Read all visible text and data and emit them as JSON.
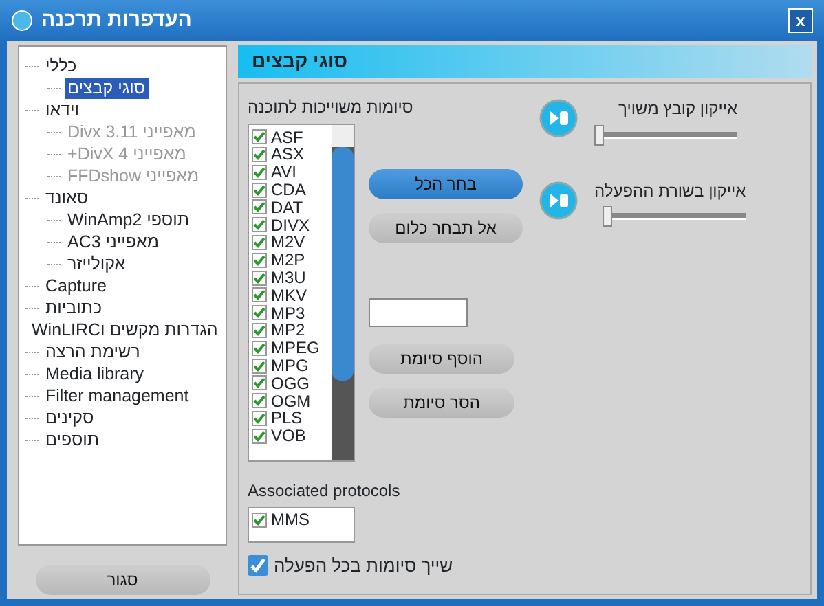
{
  "window": {
    "title": "העדפרות תרכנה",
    "close": "x"
  },
  "tree": [
    {
      "label": "כללי",
      "selected": false,
      "disabled": false,
      "children": [
        {
          "label": "סוגי קבצים",
          "selected": true,
          "disabled": false
        }
      ]
    },
    {
      "label": "וידאו",
      "selected": false,
      "disabled": false,
      "children": [
        {
          "label": "מאפייני Divx 3.11",
          "selected": false,
          "disabled": true
        },
        {
          "label": "מאפייני DivX 4+",
          "selected": false,
          "disabled": true
        },
        {
          "label": "מאפייני FFDshow",
          "selected": false,
          "disabled": true
        }
      ]
    },
    {
      "label": "סאונד",
      "selected": false,
      "disabled": false,
      "children": [
        {
          "label": "תוספי WinAmp2",
          "selected": false,
          "disabled": false
        },
        {
          "label": "מאפייני AC3",
          "selected": false,
          "disabled": false
        },
        {
          "label": "אקולייזר",
          "selected": false,
          "disabled": false
        }
      ]
    },
    {
      "label": "Capture",
      "selected": false,
      "disabled": false
    },
    {
      "label": "כתוביות",
      "selected": false,
      "disabled": false
    },
    {
      "label": "הגדרות מקשים וWinLIRC",
      "selected": false,
      "disabled": false
    },
    {
      "label": "רשימת הרצה",
      "selected": false,
      "disabled": false
    },
    {
      "label": "Media library",
      "selected": false,
      "disabled": false
    },
    {
      "label": "Filter management",
      "selected": false,
      "disabled": false
    },
    {
      "label": "סקינים",
      "selected": false,
      "disabled": false
    },
    {
      "label": "תוספים",
      "selected": false,
      "disabled": false
    }
  ],
  "close_button": "סגור",
  "panel": {
    "title": "סוגי קבצים",
    "extensions_label": "סיומות משוייכות לתוכנה",
    "extensions": [
      {
        "label": "ASF",
        "checked": true
      },
      {
        "label": "ASX",
        "checked": true
      },
      {
        "label": "AVI",
        "checked": true
      },
      {
        "label": "CDA",
        "checked": true
      },
      {
        "label": "DAT",
        "checked": true
      },
      {
        "label": "DIVX",
        "checked": true
      },
      {
        "label": "M2V",
        "checked": true
      },
      {
        "label": "M2P",
        "checked": true
      },
      {
        "label": "M3U",
        "checked": true
      },
      {
        "label": "MKV",
        "checked": true
      },
      {
        "label": "MP3",
        "checked": true
      },
      {
        "label": "MP2",
        "checked": true
      },
      {
        "label": "MPEG",
        "checked": true
      },
      {
        "label": "MPG",
        "checked": true
      },
      {
        "label": "OGG",
        "checked": true
      },
      {
        "label": "OGM",
        "checked": true
      },
      {
        "label": "PLS",
        "checked": true
      },
      {
        "label": "VOB",
        "checked": true
      }
    ],
    "select_buttons": [
      {
        "label": "בחר הכל",
        "kind": "primary"
      },
      {
        "label": "אל תבחר כלום",
        "kind": "secondary"
      }
    ],
    "extension_buttons": [
      {
        "label": "הוסף סיומת",
        "kind": "secondary"
      },
      {
        "label": "הסר סיומת",
        "kind": "secondary"
      }
    ],
    "icon_sliders": [
      {
        "label": "אייקון קובץ משויך",
        "level": 0
      },
      {
        "label": "אייקון בשורת ההפעלה",
        "level": 0
      }
    ],
    "protocols_label": "Associated protocols",
    "protocols": [
      {
        "label": "MMS",
        "checked": true
      }
    ],
    "associate_on_start": {
      "label": "שייך סיומות בכל הפעלה",
      "checked": true
    }
  }
}
